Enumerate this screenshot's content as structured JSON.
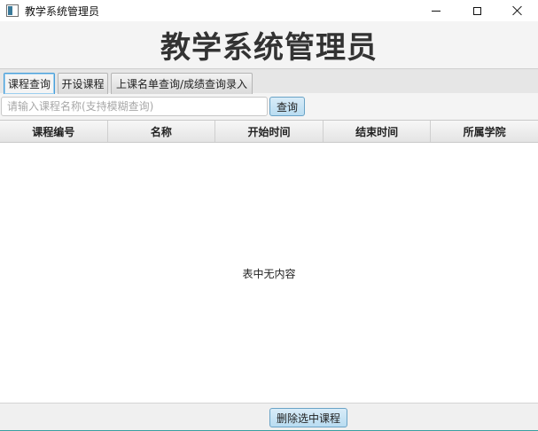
{
  "window": {
    "title": "教学系统管理员"
  },
  "header": {
    "title": "教学系统管理员"
  },
  "tabs": [
    {
      "label": "课程查询",
      "active": true
    },
    {
      "label": "开设课程",
      "active": false
    },
    {
      "label": "上课名单查询/成绩查询录入",
      "active": false
    }
  ],
  "search": {
    "value": "",
    "placeholder": "请输入课程名称(支持模糊查询)",
    "button_label": "查询"
  },
  "table": {
    "columns": [
      "课程编号",
      "名称",
      "开始时间",
      "结束时间",
      "所属学院"
    ],
    "rows": [],
    "empty_message": "表中无内容"
  },
  "footer": {
    "delete_button_label": "删除选中课程"
  },
  "colors": {
    "accent": "#4a9ed8",
    "button_bg": "#c8e3f5",
    "bottom_line": "#3a9ea0"
  }
}
